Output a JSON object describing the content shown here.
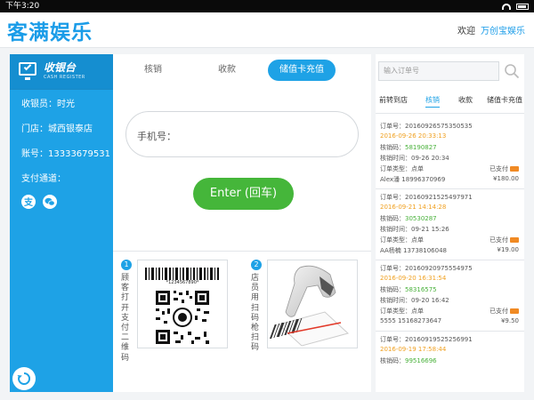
{
  "statusbar": {
    "time": "下午3:20"
  },
  "app": {
    "logo": "客满娱乐",
    "greeting": "欢迎",
    "user": "万创宝娱乐"
  },
  "sidebar": {
    "title": "收银台",
    "subtitle": "CASH REGISTER",
    "cashier": "收银员：时光",
    "store": "门店：城西银泰店",
    "account": "账号：13333679531",
    "pay_channels_label": "支付通道：",
    "pay_icons": [
      "alipay-icon",
      "wechat-icon"
    ]
  },
  "center": {
    "tabs": [
      "核销",
      "收款",
      "储值卡充值"
    ],
    "active_tab": "储值卡充值",
    "phone_label": "手机号：",
    "enter_label": "Enter (回车)",
    "step1_number": "1",
    "step1_text": "顾客打开支付二维码",
    "barcode_number": "*1234567890*",
    "step2_number": "2",
    "step2_text": "店员用扫码枪扫码"
  },
  "right": {
    "search_placeholder": "输入订单号",
    "tabs": [
      "前转到店",
      "核销",
      "收款",
      "储值卡充值"
    ],
    "active_tab": "核销",
    "orders": [
      {
        "order_no": "订单号：20160926575350535",
        "time": "2016-09-26 20:33:13",
        "code_label": "核销码：",
        "code": "58190827",
        "verify_time": "核销时间：09-26 20:34",
        "type": "订单类型：点单",
        "status": "已支付",
        "customer": "Alex潘 18996370969",
        "amount": "¥180.00"
      },
      {
        "order_no": "订单号：20160921525497971",
        "time": "2016-09-21 14:14:28",
        "code_label": "核销码：",
        "code": "30530287",
        "verify_time": "核销时间：09-21 15:26",
        "type": "订单类型：点单",
        "status": "已支付",
        "customer": "AA杨楠 13738106048",
        "amount": "¥19.00"
      },
      {
        "order_no": "订单号：20160920975554975",
        "time": "2016-09-20 16:31:54",
        "code_label": "核销码：",
        "code": "58316575",
        "verify_time": "核销时间：09-20 16:42",
        "type": "订单类型：点单",
        "status": "已支付",
        "customer": "5555 15168273647",
        "amount": "¥9.50"
      },
      {
        "order_no": "订单号：20160919525256991",
        "time": "2016-09-19 17:58:44",
        "code_label": "核销码：",
        "code": "99516696"
      }
    ]
  },
  "colors": {
    "accent": "#1ea2e6",
    "enter": "#45b63a",
    "orange": "#f0a020",
    "green": "#48b13a"
  }
}
